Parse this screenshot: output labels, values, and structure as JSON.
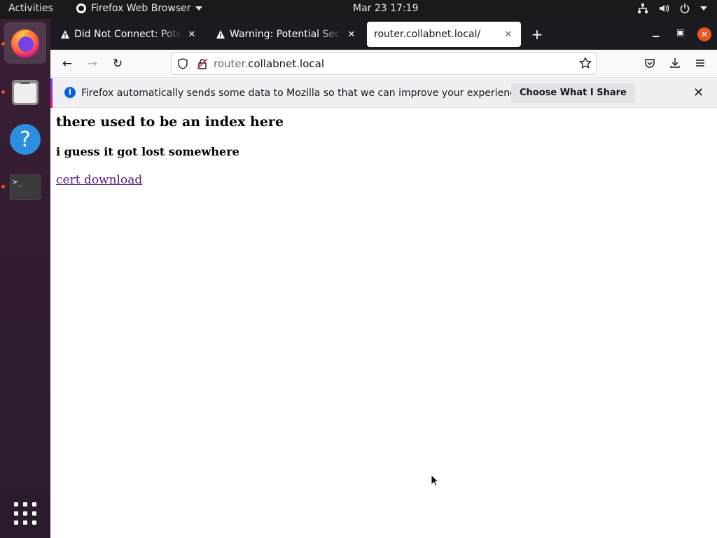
{
  "topbar": {
    "activities": "Activities",
    "app_name": "Firefox Web Browser",
    "clock": "Mar 23  17:19"
  },
  "dock": {
    "items": [
      "firefox-icon",
      "files-icon",
      "help-icon",
      "terminal-icon",
      "show-apps-icon"
    ],
    "accent_color": "#e95420"
  },
  "tabs": [
    {
      "title": "Did Not Connect: Potential Security Issue",
      "warning": true
    },
    {
      "title": "Warning: Potential Security Risk Ahead",
      "warning": true
    },
    {
      "title": "router.collabnet.local/",
      "warning": false,
      "selected": true
    }
  ],
  "urlbar": {
    "subdomain": "router.",
    "domain": "collabnet.local"
  },
  "notification": {
    "message": "Firefox automatically sends some data to Mozilla so that we can improve your experience.",
    "button": "Choose What I Share"
  },
  "page": {
    "heading": "there used to be an index here",
    "subheading": "i guess it got lost somewhere",
    "link": "cert download"
  }
}
